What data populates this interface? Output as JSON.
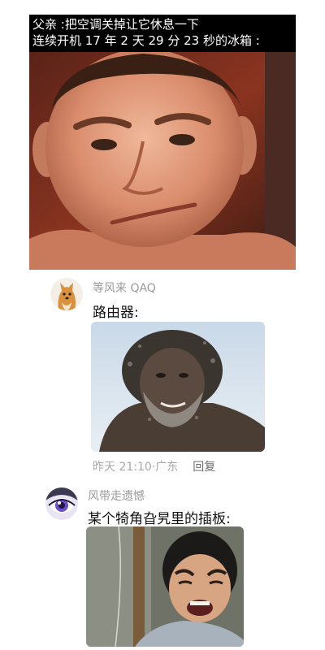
{
  "meme": {
    "caption_line1": "父亲 :把空调关掉让它休息一下",
    "caption_line2": "连续开机 17 年 2 天 29 分 23 秒的冰箱 :"
  },
  "comments": [
    {
      "username": "等风来 QAQ",
      "text": "路由器:",
      "time": "昨天 21:10",
      "separator": "·",
      "location": "广东",
      "reply_label": "回复"
    },
    {
      "username": "风带走遗憾",
      "text": "某个犄角旮旯里的插板:"
    }
  ]
}
